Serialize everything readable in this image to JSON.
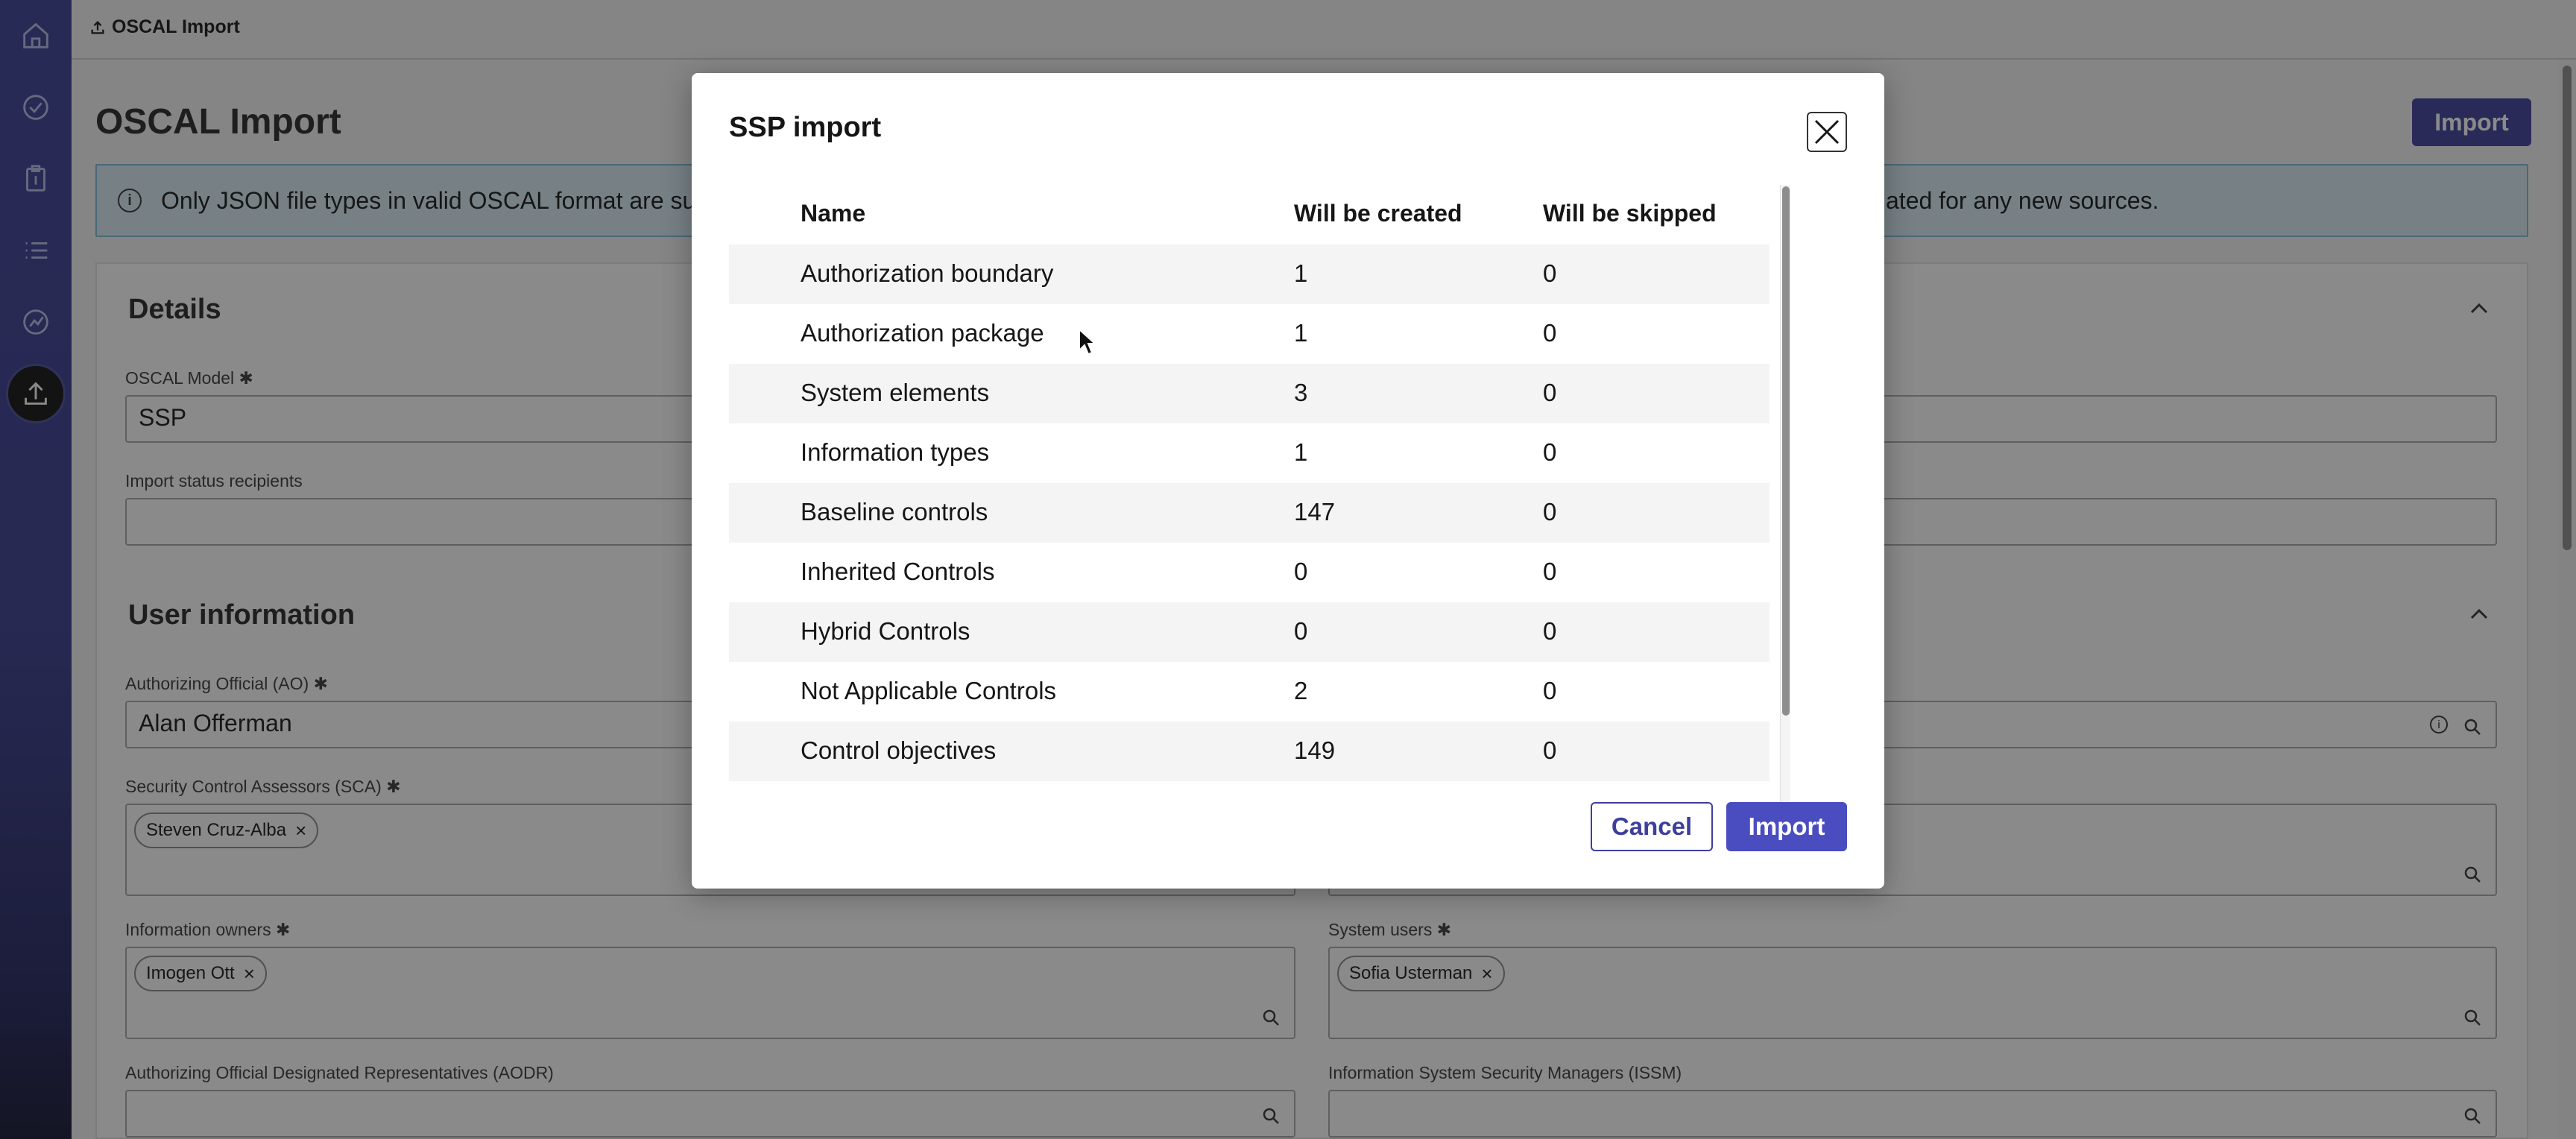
{
  "app": {
    "breadcrumb": "OSCAL Import",
    "page_title": "OSCAL Import",
    "top_import_label": "Import"
  },
  "sidebar": {
    "items": [
      {
        "icon": "home-icon"
      },
      {
        "icon": "check-circle-icon"
      },
      {
        "icon": "clipboard-icon"
      },
      {
        "icon": "list-icon"
      },
      {
        "icon": "chart-icon"
      },
      {
        "icon": "upload-icon",
        "active": true
      }
    ]
  },
  "banner": {
    "text_left": "Only JSON file types in valid OSCAL format are sup",
    "text_right": "ated for any new sources."
  },
  "details": {
    "title": "Details",
    "model_label": "OSCAL Model",
    "model_value": "SSP",
    "recipients_label": "Import status recipients",
    "recipients_value": ""
  },
  "user_info": {
    "title": "User information",
    "ao_label": "Authorizing Official (AO)",
    "ao_value": "Alan Offerman",
    "sca_label": "Security Control Assessors (SCA)",
    "sca_tag": "Steven Cruz-Alba",
    "owners_label": "Information owners",
    "owners_tag": "Imogen Ott",
    "users_label": "System users",
    "users_tag": "Sofia Usterman",
    "aodr_label": "Authorizing Official Designated Representatives (AODR)",
    "issm_label": "Information System Security Managers (ISSM)"
  },
  "modal": {
    "title": "SSP import",
    "columns": [
      "Name",
      "Will be created",
      "Will be skipped"
    ],
    "rows": [
      {
        "name": "Authorization boundary",
        "created": "1",
        "skipped": "0"
      },
      {
        "name": "Authorization package",
        "created": "1",
        "skipped": "0"
      },
      {
        "name": "System elements",
        "created": "3",
        "skipped": "0"
      },
      {
        "name": "Information types",
        "created": "1",
        "skipped": "0"
      },
      {
        "name": "Baseline controls",
        "created": "147",
        "skipped": "0"
      },
      {
        "name": "Inherited Controls",
        "created": "0",
        "skipped": "0"
      },
      {
        "name": "Hybrid Controls",
        "created": "0",
        "skipped": "0"
      },
      {
        "name": "Not Applicable Controls",
        "created": "2",
        "skipped": "0"
      },
      {
        "name": "Control objectives",
        "created": "149",
        "skipped": "0"
      }
    ],
    "cancel_label": "Cancel",
    "import_label": "Import"
  },
  "colors": {
    "accent": "#3e3f9c",
    "sidebar": "#3b3f97",
    "banner_bg": "#d9ecf5"
  }
}
